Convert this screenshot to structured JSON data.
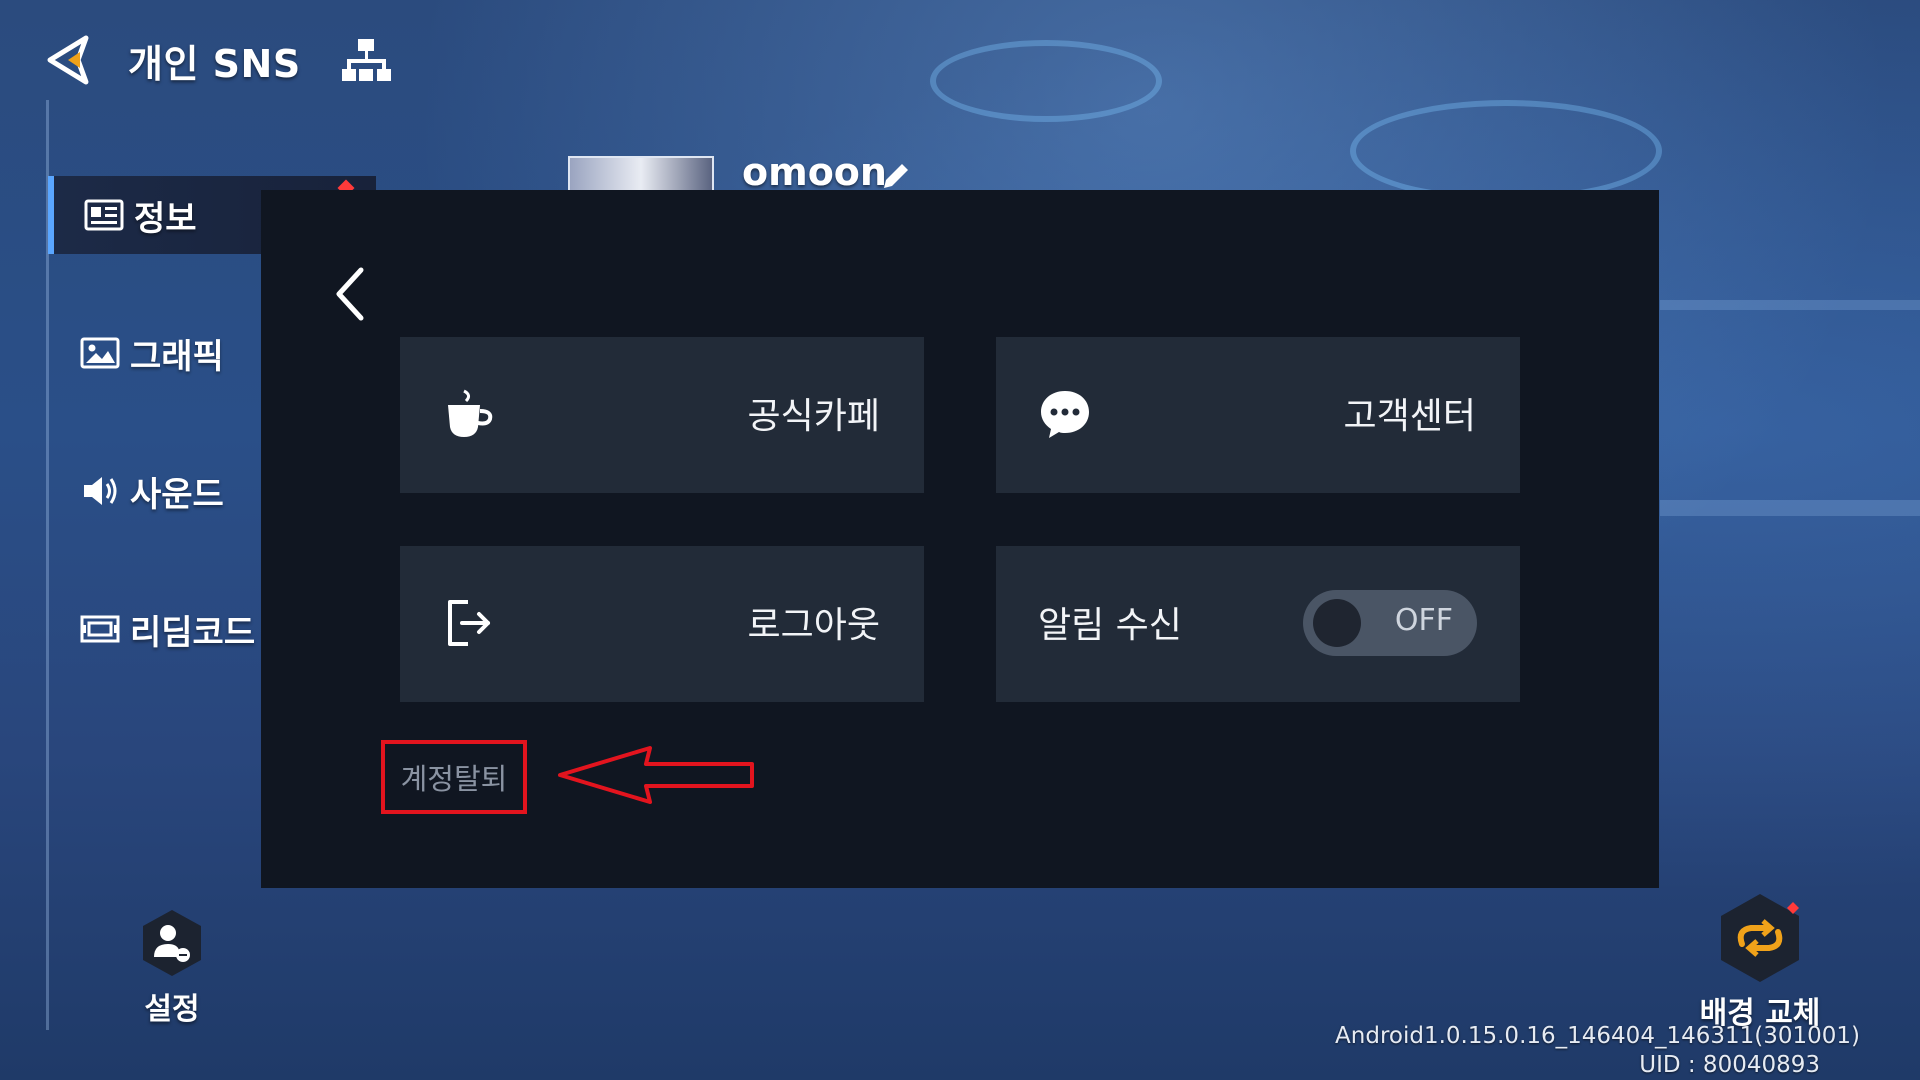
{
  "header": {
    "title": "개인 SNS"
  },
  "sidebar": {
    "items": [
      {
        "label": "정보",
        "icon": "id-card-icon",
        "active": true
      },
      {
        "label": "그래픽",
        "icon": "image-icon"
      },
      {
        "label": "사운드",
        "icon": "speaker-icon"
      },
      {
        "label": "리딤코드",
        "icon": "coupon-icon"
      }
    ]
  },
  "profile": {
    "username": "omoon"
  },
  "modal": {
    "cards": {
      "cafe": {
        "label": "공식카페",
        "icon": "coffee-cup-icon"
      },
      "support": {
        "label": "고객센터",
        "icon": "chat-bubble-icon"
      },
      "logout": {
        "label": "로그아웃",
        "icon": "logout-icon"
      },
      "notifications": {
        "label": "알림 수신",
        "toggle_state": "OFF"
      }
    },
    "withdraw_label": "계정탈퇴"
  },
  "footer": {
    "settings_label": "설정",
    "background_label": "배경 교체",
    "version": "Android1.0.15.0.16_146404_146311(301001)",
    "uid": "UID : 80040893"
  },
  "colors": {
    "modal_bg": "#101621",
    "card_bg": "#222b38",
    "highlight_red": "#e3141e",
    "accent_orange": "#f0a21a"
  }
}
